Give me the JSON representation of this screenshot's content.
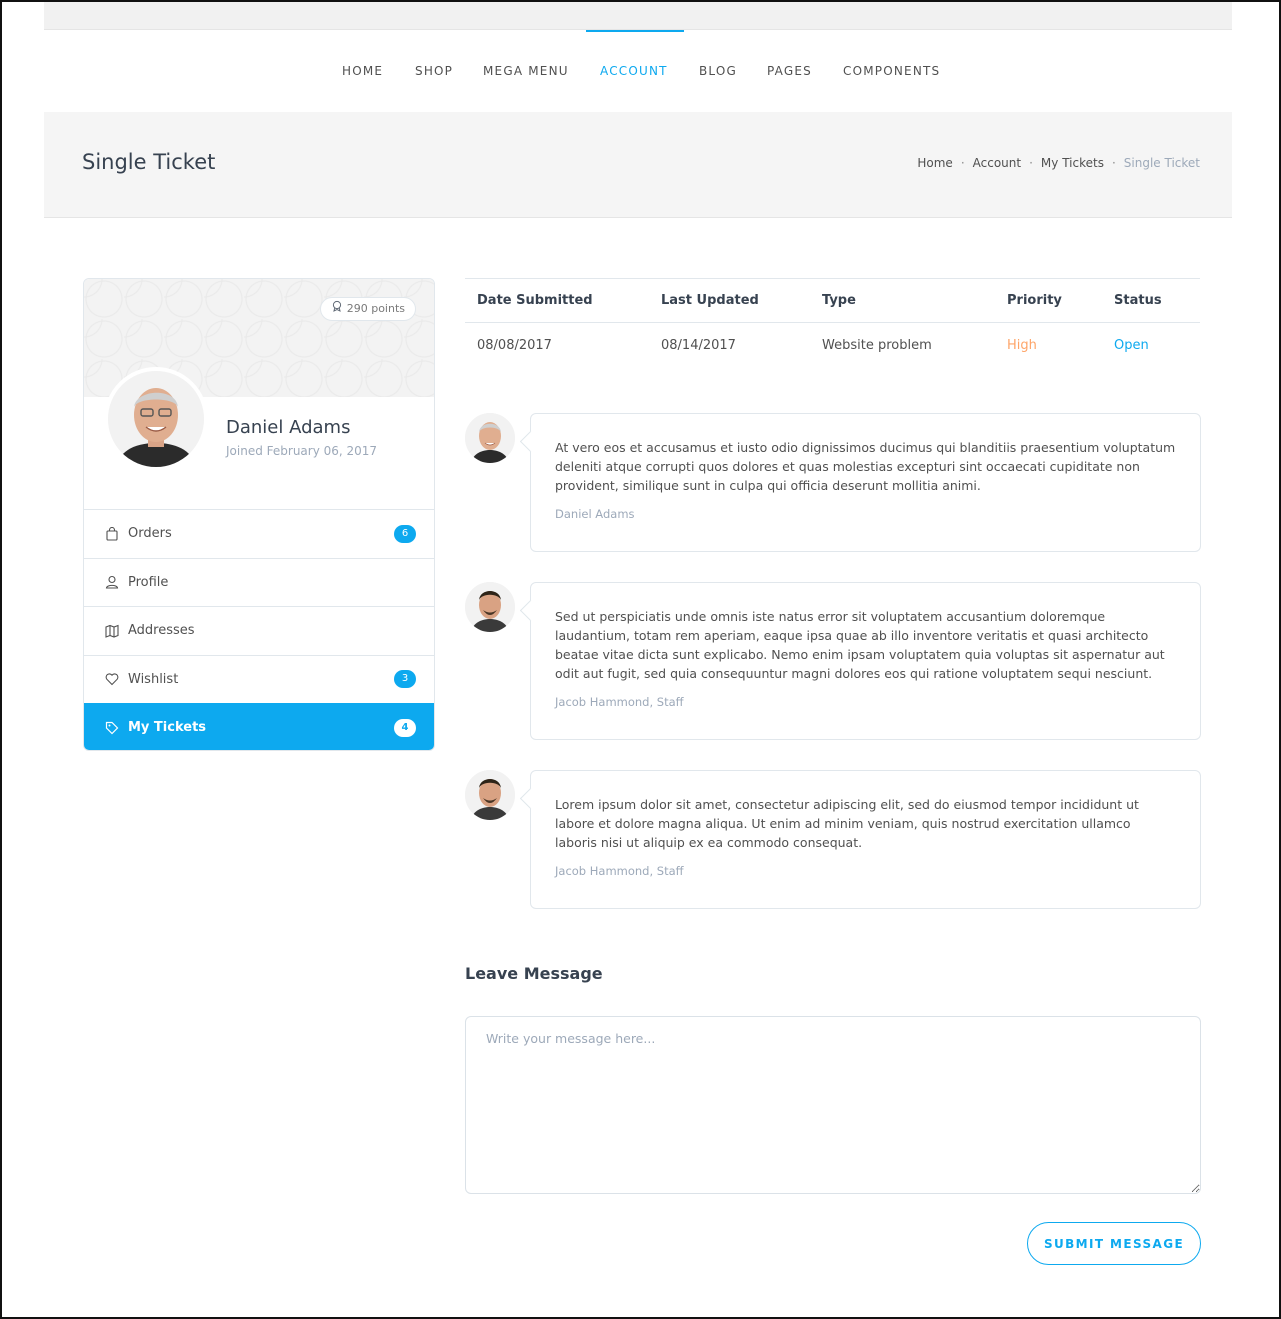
{
  "nav": {
    "items": [
      {
        "label": "HOME"
      },
      {
        "label": "SHOP"
      },
      {
        "label": "MEGA MENU"
      },
      {
        "label": "ACCOUNT",
        "active": true
      },
      {
        "label": "BLOG"
      },
      {
        "label": "PAGES"
      },
      {
        "label": "COMPONENTS"
      }
    ]
  },
  "page": {
    "title": "Single Ticket",
    "breadcrumb": [
      "Home",
      "Account",
      "My Tickets",
      "Single Ticket"
    ]
  },
  "profile": {
    "points": "290 points",
    "name": "Daniel Adams",
    "joined": "Joined February 06, 2017",
    "menu": [
      {
        "label": "Orders",
        "icon": "bag-icon",
        "badge": "6"
      },
      {
        "label": "Profile",
        "icon": "user-icon",
        "badge": ""
      },
      {
        "label": "Addresses",
        "icon": "map-icon",
        "badge": ""
      },
      {
        "label": "Wishlist",
        "icon": "heart-icon",
        "badge": "3"
      },
      {
        "label": "My Tickets",
        "icon": "tag-icon",
        "badge": "4",
        "active": true
      }
    ]
  },
  "ticket": {
    "headers": [
      "Date Submitted",
      "Last Updated",
      "Type",
      "Priority",
      "Status"
    ],
    "row": {
      "date_submitted": "08/08/2017",
      "last_updated": "08/14/2017",
      "type": "Website problem",
      "priority": "High",
      "status": "Open"
    }
  },
  "comments": [
    {
      "text": "At vero eos et accusamus et iusto odio dignissimos ducimus qui blanditiis praesentium voluptatum deleniti atque corrupti quos dolores et quas molestias excepturi sint occaecati cupiditate non provident, similique sunt in culpa qui officia deserunt mollitia animi.",
      "author": "Daniel Adams"
    },
    {
      "text": "Sed ut perspiciatis unde omnis iste natus error sit voluptatem accusantium doloremque laudantium, totam rem aperiam, eaque ipsa quae ab illo inventore veritatis et quasi architecto beatae vitae dicta sunt explicabo. Nemo enim ipsam voluptatem quia voluptas sit aspernatur aut odit aut fugit, sed quia consequuntur magni dolores eos qui ratione voluptatem sequi nesciunt.",
      "author": "Jacob Hammond, Staff"
    },
    {
      "text": "Lorem ipsum dolor sit amet, consectetur adipiscing elit, sed do eiusmod tempor incididunt ut labore et dolore magna aliqua. Ut enim ad minim veniam, quis nostrud exercitation ullamco laboris nisi ut aliquip ex ea commodo consequat.",
      "author": "Jacob Hammond, Staff"
    }
  ],
  "leave_message": {
    "title": "Leave Message",
    "placeholder": "Write your message here...",
    "submit_label": "SUBMIT MESSAGE"
  },
  "colors": {
    "accent": "#0da9ef",
    "warning": "#fea569",
    "text": "#505050",
    "muted": "#9da9b9"
  }
}
